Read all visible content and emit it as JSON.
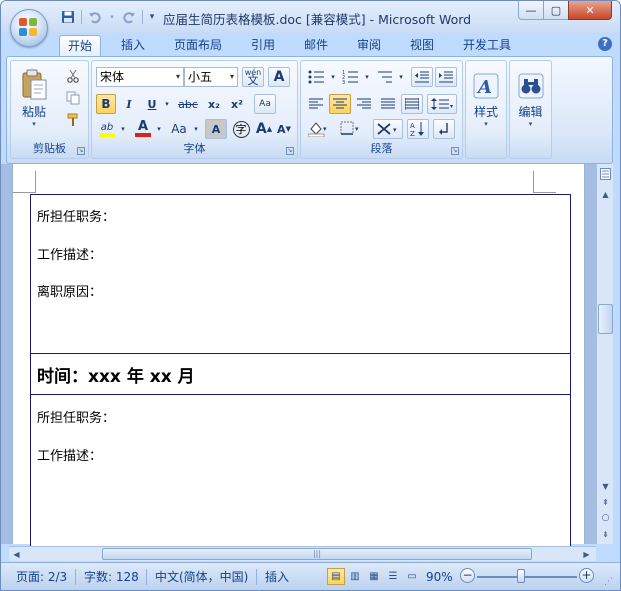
{
  "window": {
    "title": "应届生简历表格模板.doc [兼容模式] - Microsoft Word",
    "controls": {
      "minimize": "—",
      "maximize": "▢",
      "close": "✕"
    }
  },
  "qat": {
    "save_icon": "save-icon",
    "undo_icon": "undo-icon",
    "redo_icon": "redo-icon",
    "customize": "▾"
  },
  "tabs": [
    {
      "label": "开始",
      "active": true
    },
    {
      "label": "插入",
      "active": false
    },
    {
      "label": "页面布局",
      "active": false
    },
    {
      "label": "引用",
      "active": false
    },
    {
      "label": "邮件",
      "active": false
    },
    {
      "label": "审阅",
      "active": false
    },
    {
      "label": "视图",
      "active": false
    },
    {
      "label": "开发工具",
      "active": false
    }
  ],
  "help_label": "?",
  "ribbon": {
    "clipboard": {
      "label": "剪贴板",
      "paste_label": "粘贴",
      "paste_arrow": "▾"
    },
    "font": {
      "label": "字体",
      "font_name": "宋体",
      "font_size": "小五",
      "phonetic": "wén",
      "char_border": "A",
      "bold": "B",
      "italic": "I",
      "underline": "U",
      "strike": "abc",
      "subscript": "x₂",
      "superscript": "x²",
      "clear_format": "Aa",
      "highlight": "ab",
      "font_color": "A",
      "change_case": "Aa",
      "shading": "A",
      "enclose": "字",
      "grow": "A",
      "shrink": "A"
    },
    "paragraph": {
      "label": "段落"
    },
    "styles": {
      "label": "样式",
      "arrow": "▾"
    },
    "editing": {
      "label": "编辑",
      "arrow": "▾"
    }
  },
  "document": {
    "block1": {
      "duty": "所担任职务：",
      "desc": "工作描述：",
      "reason": "离职原因："
    },
    "time_heading": "时间：xxx 年 xx 月",
    "block2": {
      "duty": "所担任职务：",
      "desc": "工作描述："
    }
  },
  "status": {
    "page": "页面: 2/3",
    "words": "字数: 128",
    "language": "中文(简体，中国)",
    "mode": "插入",
    "zoom": "90%",
    "zoom_level_percent": 90
  },
  "colors": {
    "ribbon_blue": "#bfdbff",
    "highlight_yellow": "#ffd35a",
    "font_color_red": "#e02020",
    "table_border": "#1a1a6e"
  }
}
